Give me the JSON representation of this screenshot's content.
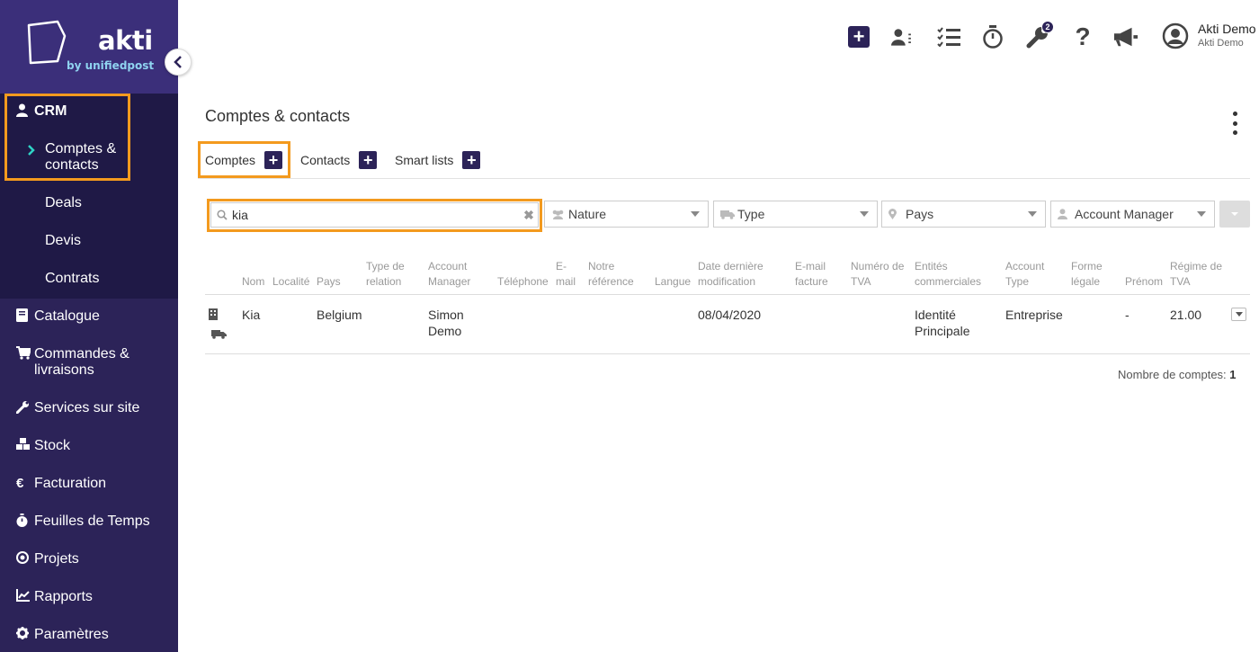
{
  "brand": {
    "name": "akti",
    "tagline": "by unifiedpost"
  },
  "sidebar": {
    "crm_label": "CRM",
    "crm_sub": [
      {
        "label_l1": "Comptes &",
        "label_l2": "contacts"
      },
      {
        "label": "Deals"
      },
      {
        "label": "Devis"
      },
      {
        "label": "Contrats"
      }
    ],
    "items": [
      {
        "label": "Catalogue"
      },
      {
        "label_l1": "Commandes &",
        "label_l2": "livraisons"
      },
      {
        "label": "Services sur site"
      },
      {
        "label": "Stock"
      },
      {
        "label": "Facturation"
      },
      {
        "label": "Feuilles de Temps"
      },
      {
        "label": "Projets"
      },
      {
        "label": "Rapports"
      },
      {
        "label": "Paramètres"
      }
    ]
  },
  "topbar": {
    "notifications_badge": "2",
    "user_name": "Akti Demo",
    "user_company": "Akti Demo"
  },
  "page": {
    "title": "Comptes & contacts",
    "tabs": [
      {
        "label": "Comptes"
      },
      {
        "label": "Contacts"
      },
      {
        "label": "Smart lists"
      }
    ]
  },
  "filters": {
    "search_value": "kia",
    "nature": "Nature",
    "type": "Type",
    "pays": "Pays",
    "account_manager": "Account Manager"
  },
  "table": {
    "headers": {
      "nom": "Nom",
      "localite": "Localité",
      "pays": "Pays",
      "type_relation_l1": "Type de",
      "type_relation_l2": "relation",
      "account_manager_l1": "Account",
      "account_manager_l2": "Manager",
      "telephone": "Téléphone",
      "email_l1": "E-",
      "email_l2": "mail",
      "notre_ref_l1": "Notre",
      "notre_ref_l2": "référence",
      "langue": "Langue",
      "date_l1": "Date dernière",
      "date_l2": "modification",
      "email_fact_l1": "E-mail",
      "email_fact_l2": "facture",
      "tva_l1": "Numéro de",
      "tva_l2": "TVA",
      "entites_l1": "Entités",
      "entites_l2": "commerciales",
      "account_type_l1": "Account",
      "account_type_l2": "Type",
      "forme_l1": "Forme",
      "forme_l2": "légale",
      "prenom": "Prénom",
      "regime_l1": "Régime de",
      "regime_l2": "TVA"
    },
    "rows": [
      {
        "nom": "Kia",
        "pays": "Belgium",
        "manager_l1": "Simon",
        "manager_l2": "Demo",
        "date": "08/04/2020",
        "entite_l1": "Identité",
        "entite_l2": "Principale",
        "account_type": "Entreprise",
        "prenom": "-",
        "regime": "21.00"
      }
    ]
  },
  "footer": {
    "count_label": "Nombre de comptes:",
    "count_value": "1"
  },
  "colors": {
    "sidebar": "#2c2358",
    "sidebar_active": "#1f1946",
    "highlight": "#f39a1e",
    "accent": "#2ed3c5"
  }
}
